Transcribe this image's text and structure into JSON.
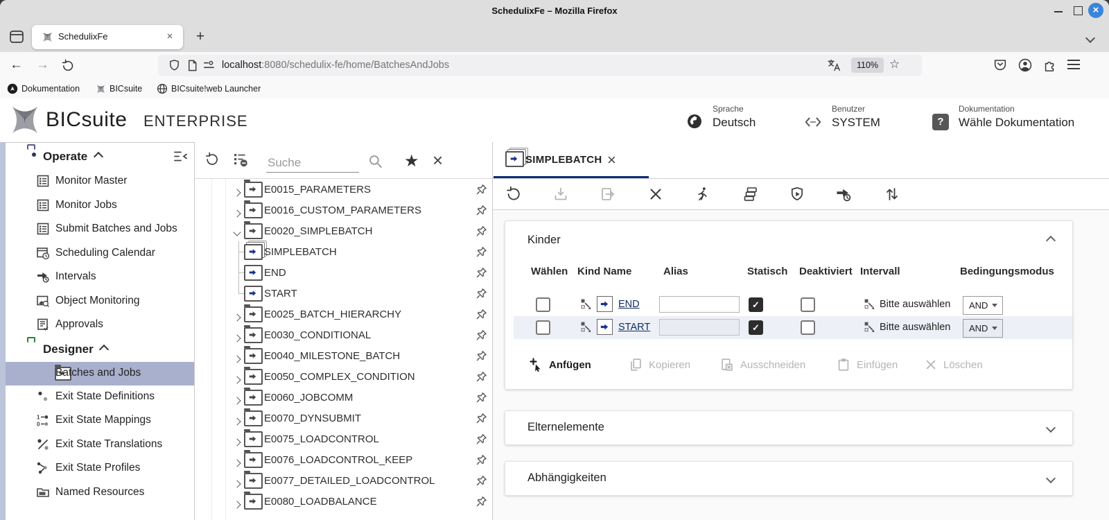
{
  "window": {
    "title": "SchedulixFe – Mozilla Firefox"
  },
  "browser": {
    "tab_title": "SchedulixFe",
    "url_host": "localhost",
    "url_rest": ":8080/schedulix-fe/home/BatchesAndJobs",
    "zoom_badge": "110%",
    "bookmarks": [
      {
        "label": "Dokumentation"
      },
      {
        "label": "BICsuite"
      },
      {
        "label": "BICsuite!web Launcher"
      }
    ]
  },
  "appheader": {
    "brand": "BICsuite",
    "edition": "ENTERPRISE",
    "help_glyph": "?",
    "info": [
      {
        "label": "Sprache",
        "value": "Deutsch"
      },
      {
        "label": "Benutzer",
        "value": "SYSTEM"
      },
      {
        "label": "Dokumentation",
        "value": "Wähle Dokumentation"
      }
    ]
  },
  "sidebar": {
    "sections": [
      {
        "label": "Operate",
        "items": [
          {
            "label": "Monitor Master"
          },
          {
            "label": "Monitor Jobs"
          },
          {
            "label": "Submit Batches and Jobs"
          },
          {
            "label": "Scheduling Calendar"
          },
          {
            "label": "Intervals"
          },
          {
            "label": "Object Monitoring"
          },
          {
            "label": "Approvals"
          }
        ]
      },
      {
        "label": "Designer",
        "items": [
          {
            "label": "Batches and Jobs",
            "selected": true
          },
          {
            "label": "Exit State Definitions"
          },
          {
            "label": "Exit State Mappings"
          },
          {
            "label": "Exit State Translations"
          },
          {
            "label": "Exit State Profiles"
          },
          {
            "label": "Named Resources"
          }
        ]
      }
    ]
  },
  "treepanel": {
    "search_placeholder": "Suche",
    "items": [
      {
        "label": "E0015_PARAMETERS",
        "type": "batch-folder",
        "expanded": false
      },
      {
        "label": "E0016_CUSTOM_PARAMETERS",
        "type": "batch-folder",
        "expanded": false
      },
      {
        "label": "E0020_SIMPLEBATCH",
        "type": "batch-folder",
        "expanded": true
      },
      {
        "label": "SIMPLEBATCH",
        "type": "batch",
        "child": true
      },
      {
        "label": "END",
        "type": "job",
        "child": true
      },
      {
        "label": "START",
        "type": "job",
        "child": true
      },
      {
        "label": "E0025_BATCH_HIERARCHY",
        "type": "batch-folder",
        "expanded": false
      },
      {
        "label": "E0030_CONDITIONAL",
        "type": "batch-folder",
        "expanded": false
      },
      {
        "label": "E0040_MILESTONE_BATCH",
        "type": "batch-folder",
        "expanded": false
      },
      {
        "label": "E0050_COMPLEX_CONDITION",
        "type": "batch-folder",
        "expanded": false
      },
      {
        "label": "E0060_JOBCOMM",
        "type": "batch-folder",
        "expanded": false
      },
      {
        "label": "E0070_DYNSUBMIT",
        "type": "batch-folder",
        "expanded": false
      },
      {
        "label": "E0075_LOADCONTROL",
        "type": "batch-folder",
        "expanded": false
      },
      {
        "label": "E0076_LOADCONTROL_KEEP",
        "type": "batch-folder",
        "expanded": false
      },
      {
        "label": "E0077_DETAILED_LOADCONTROL",
        "type": "batch-folder",
        "expanded": false
      },
      {
        "label": "E0080_LOADBALANCE",
        "type": "batch-folder",
        "expanded": false
      }
    ]
  },
  "detail": {
    "tab_title": "SIMPLEBATCH",
    "kinder": {
      "title": "Kinder",
      "columns": [
        "Wählen",
        "Kind Name",
        "Alias",
        "Statisch",
        "Deaktiviert",
        "Intervall",
        "Bedingungsmodus"
      ],
      "rows": [
        {
          "name": "END",
          "alias": "",
          "statisch": true,
          "deaktiviert": false,
          "intervall": "Bitte auswählen",
          "modus": "AND"
        },
        {
          "name": "START",
          "alias": "",
          "statisch": true,
          "deaktiviert": false,
          "intervall": "Bitte auswählen",
          "modus": "AND"
        }
      ],
      "actions": [
        {
          "label": "Anfügen",
          "enabled": true
        },
        {
          "label": "Kopieren",
          "enabled": false
        },
        {
          "label": "Ausschneiden",
          "enabled": false
        },
        {
          "label": "Einfügen",
          "enabled": false
        },
        {
          "label": "Löschen",
          "enabled": false
        }
      ]
    },
    "collapsed_sections": [
      {
        "title": "Elternelemente"
      },
      {
        "title": "Abhängigkeiten"
      }
    ]
  },
  "colors": {
    "accent_navy": "#10307c",
    "selected_item_bg": "#a9b0cd",
    "designer_green": "#3aa04a",
    "close_button_blue": "#3a85dc"
  }
}
